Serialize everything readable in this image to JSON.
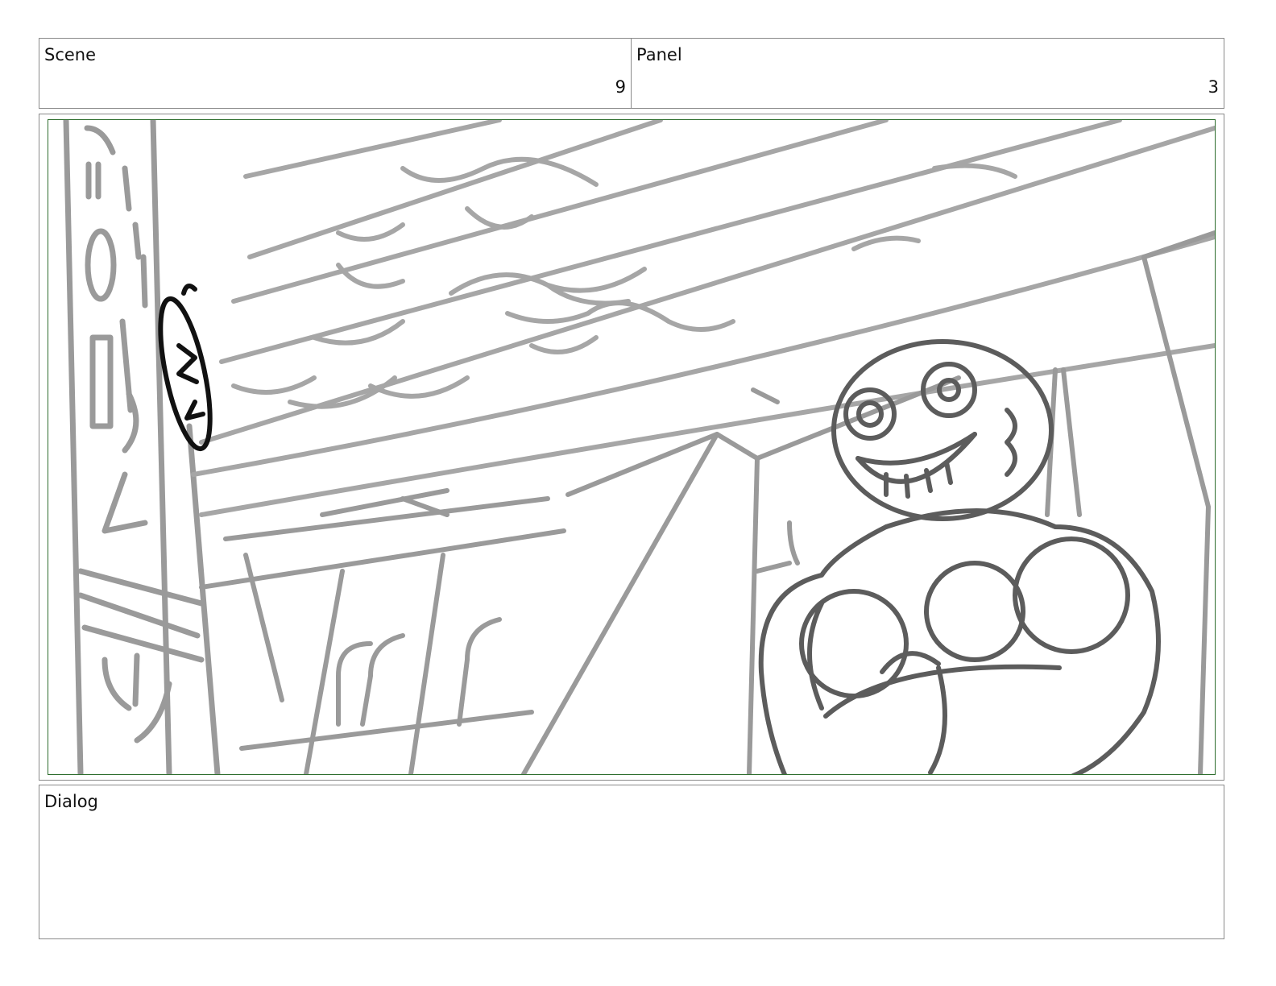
{
  "header": {
    "scene_label": "Scene",
    "scene_number": "9",
    "panel_label": "Panel",
    "panel_number": "3"
  },
  "dialog": {
    "label": "Dialog",
    "text": ""
  },
  "colors": {
    "frame_border": "#2f6e2f",
    "box_border": "#8a8a8a",
    "sketch_line": "#9a9a9a",
    "character_line": "#5c5c5c",
    "ink": "#111111"
  }
}
